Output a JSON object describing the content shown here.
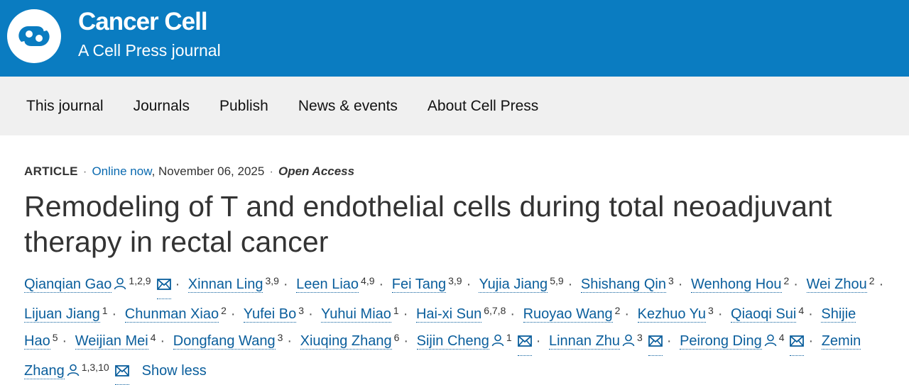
{
  "brand": {
    "title": "Cancer Cell",
    "subtitle": "A Cell Press journal",
    "color": "#0a7cc1"
  },
  "nav": {
    "items": [
      "This journal",
      "Journals",
      "Publish",
      "News & events",
      "About Cell Press"
    ]
  },
  "article": {
    "type": "ARTICLE",
    "status": "Online now",
    "date": ", November 06, 2025",
    "access": "Open Access",
    "title": "Remodeling of T and endothelial cells during total neoadjuvant therapy in rectal cancer"
  },
  "authors": [
    {
      "name": "Qianqian Gao",
      "sup": "1,2,9",
      "profile": true,
      "email": true
    },
    {
      "name": "Xinnan Ling",
      "sup": "3,9",
      "profile": false,
      "email": false
    },
    {
      "name": "Leen Liao",
      "sup": "4,9",
      "profile": false,
      "email": false
    },
    {
      "name": "Fei Tang",
      "sup": "3,9",
      "profile": false,
      "email": false
    },
    {
      "name": "Yujia Jiang",
      "sup": "5,9",
      "profile": false,
      "email": false
    },
    {
      "name": "Shishang Qin",
      "sup": "3",
      "profile": false,
      "email": false
    },
    {
      "name": "Wenhong Hou",
      "sup": "2",
      "profile": false,
      "email": false
    },
    {
      "name": "Wei Zhou",
      "sup": "2",
      "profile": false,
      "email": false
    },
    {
      "name": "Lijuan Jiang",
      "sup": "1",
      "profile": false,
      "email": false
    },
    {
      "name": "Chunman Xiao",
      "sup": "2",
      "profile": false,
      "email": false
    },
    {
      "name": "Yufei Bo",
      "sup": "3",
      "profile": false,
      "email": false
    },
    {
      "name": "Yuhui Miao",
      "sup": "1",
      "profile": false,
      "email": false
    },
    {
      "name": "Hai-xi Sun",
      "sup": "6,7,8",
      "profile": false,
      "email": false
    },
    {
      "name": "Ruoyao Wang",
      "sup": "2",
      "profile": false,
      "email": false
    },
    {
      "name": "Kezhuo Yu",
      "sup": "3",
      "profile": false,
      "email": false
    },
    {
      "name": "Qiaoqi Sui",
      "sup": "4",
      "profile": false,
      "email": false
    },
    {
      "name": "Shijie Hao",
      "sup": "5",
      "profile": false,
      "email": false
    },
    {
      "name": "Weijian Mei",
      "sup": "4",
      "profile": false,
      "email": false
    },
    {
      "name": "Dongfang Wang",
      "sup": "3",
      "profile": false,
      "email": false
    },
    {
      "name": "Xiuqing Zhang",
      "sup": "6",
      "profile": false,
      "email": false
    },
    {
      "name": "Sijin Cheng",
      "sup": "1",
      "profile": true,
      "email": true
    },
    {
      "name": "Linnan Zhu",
      "sup": "3",
      "profile": true,
      "email": true
    },
    {
      "name": "Peirong Ding",
      "sup": "4",
      "profile": true,
      "email": true
    },
    {
      "name": "Zemin Zhang",
      "sup": "1,3,10",
      "profile": true,
      "email": true
    }
  ],
  "show_less_label": "Show less"
}
